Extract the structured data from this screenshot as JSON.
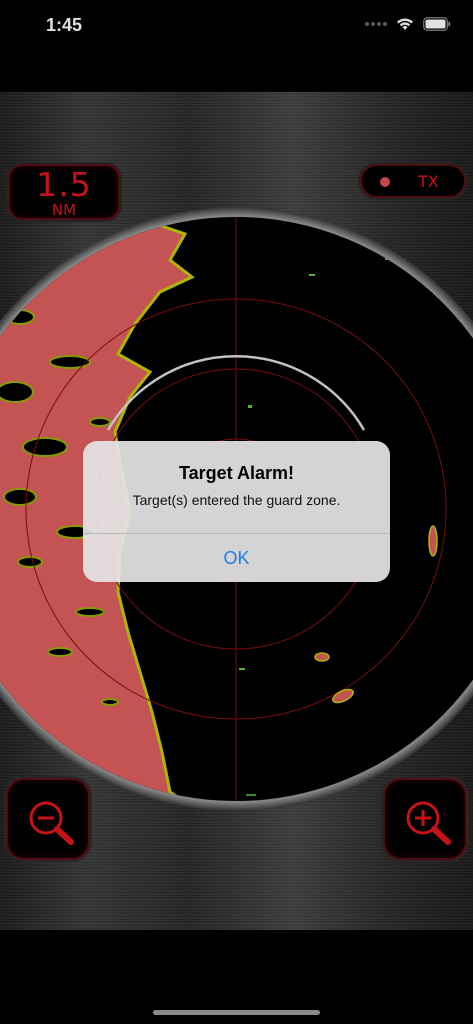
{
  "status_bar": {
    "time": "1:45"
  },
  "radar": {
    "range_value": "1.5",
    "range_unit": "NM",
    "tx_label": "TX",
    "echo_color": "#e06060",
    "echo_edge_color": "#c8d000",
    "ring_color": "#8a1010",
    "display_color": "#e0161b"
  },
  "controls": {
    "zoom_out_icon": "zoom-out-magnifier-icon",
    "zoom_in_icon": "zoom-in-magnifier-icon"
  },
  "alert": {
    "title": "Target Alarm!",
    "message": "Target(s) entered the guard zone.",
    "ok_label": "OK",
    "ok_color": "#1a7ef0"
  }
}
